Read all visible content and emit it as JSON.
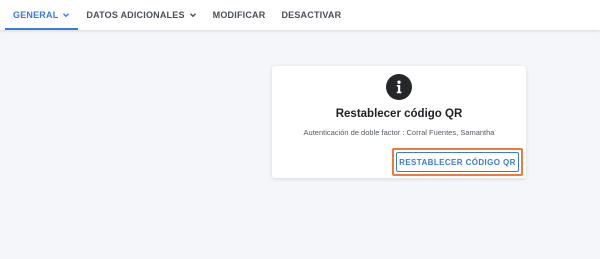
{
  "tabs": [
    {
      "label": "GENERAL",
      "active": true,
      "has_dropdown": true
    },
    {
      "label": "DATOS ADICIONALES",
      "active": false,
      "has_dropdown": true
    },
    {
      "label": "MODIFICAR",
      "active": false,
      "has_dropdown": false
    },
    {
      "label": "DESACTIVAR",
      "active": false,
      "has_dropdown": false
    }
  ],
  "card": {
    "icon": "info-icon",
    "title": "Restablecer código QR",
    "subtitle": "Autenticación de doble factor : Corral Fuentes, Samantha",
    "button_label": "RESTABLECER CÓDIGO QR"
  },
  "colors": {
    "accent": "#3a7bd5",
    "highlight": "#f07a3a",
    "icon_bg": "#25272b",
    "page_bg": "#f4f6fa"
  }
}
